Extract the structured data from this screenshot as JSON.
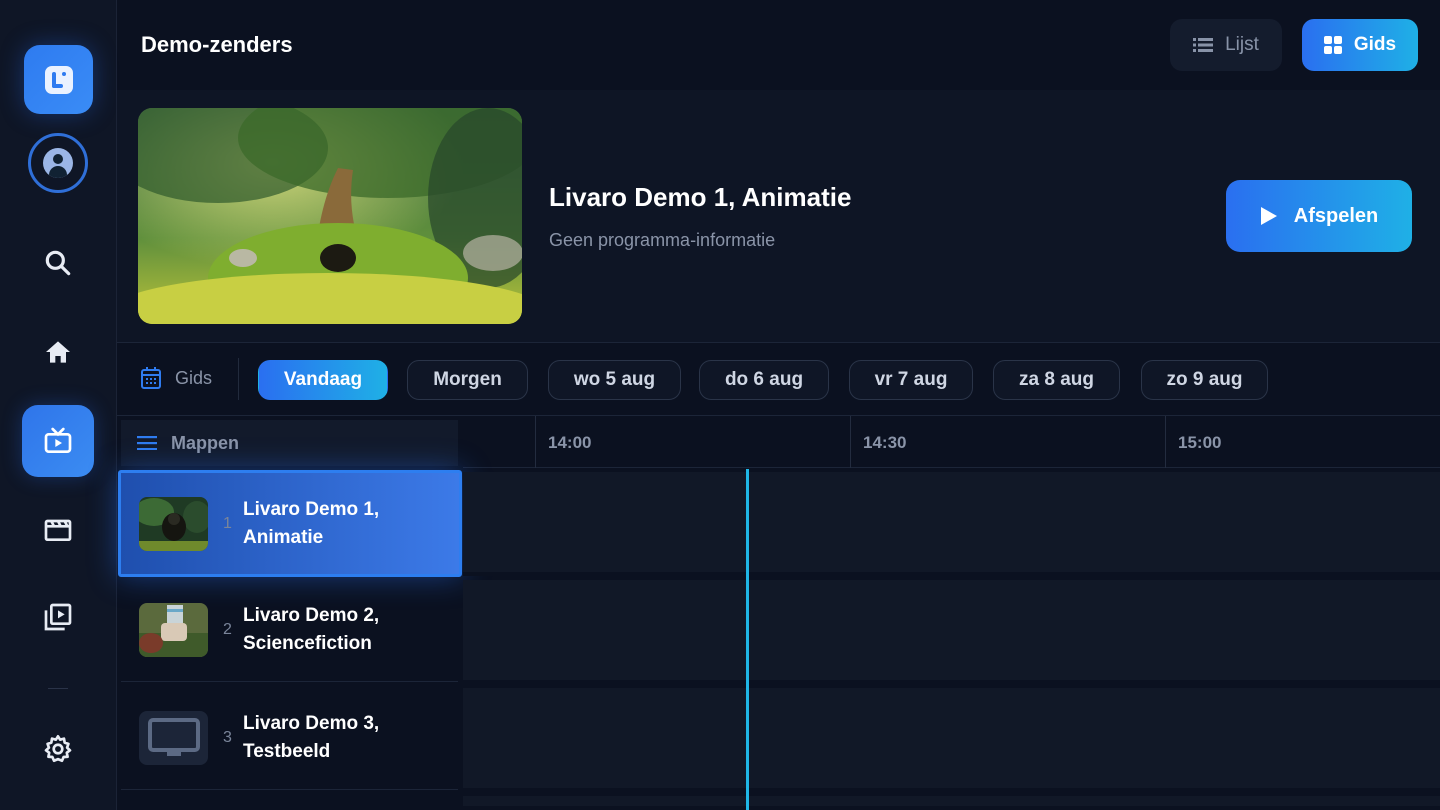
{
  "header": {
    "title": "Demo-zenders",
    "view_list_label": "Lijst",
    "view_guide_label": "Gids"
  },
  "sidebar": {
    "items": [
      {
        "name": "search",
        "icon": "search-icon"
      },
      {
        "name": "home",
        "icon": "home-icon"
      },
      {
        "name": "live-tv",
        "icon": "tv-icon",
        "active": true
      },
      {
        "name": "movies",
        "icon": "clapperboard-icon"
      },
      {
        "name": "library",
        "icon": "video-library-icon"
      },
      {
        "name": "settings",
        "icon": "gear-icon"
      }
    ]
  },
  "hero": {
    "title": "Livaro Demo 1, Animatie",
    "subtitle": "Geen programma-informatie",
    "play_label": "Afspelen"
  },
  "daybar": {
    "label": "Gids",
    "days": [
      "Vandaag",
      "Morgen",
      "wo 5 aug",
      "do 6 aug",
      "vr 7 aug",
      "za 8 aug",
      "zo 9 aug"
    ],
    "selected": "Vandaag"
  },
  "grid": {
    "folders_label": "Mappen",
    "times": [
      "14:00",
      "14:30",
      "15:00"
    ],
    "channels": [
      {
        "number": "1",
        "name_line1": "Livaro Demo 1,",
        "name_line2": "Animatie",
        "selected": true
      },
      {
        "number": "2",
        "name_line1": "Livaro Demo 2,",
        "name_line2": "Sciencefiction"
      },
      {
        "number": "3",
        "name_line1": "Livaro Demo 3,",
        "name_line2": "Testbeeld"
      }
    ]
  },
  "colors": {
    "accent": "#2a6ff0",
    "accent2": "#1fb0e6",
    "now_line": "#1fb6e6",
    "background": "#0b1120"
  }
}
